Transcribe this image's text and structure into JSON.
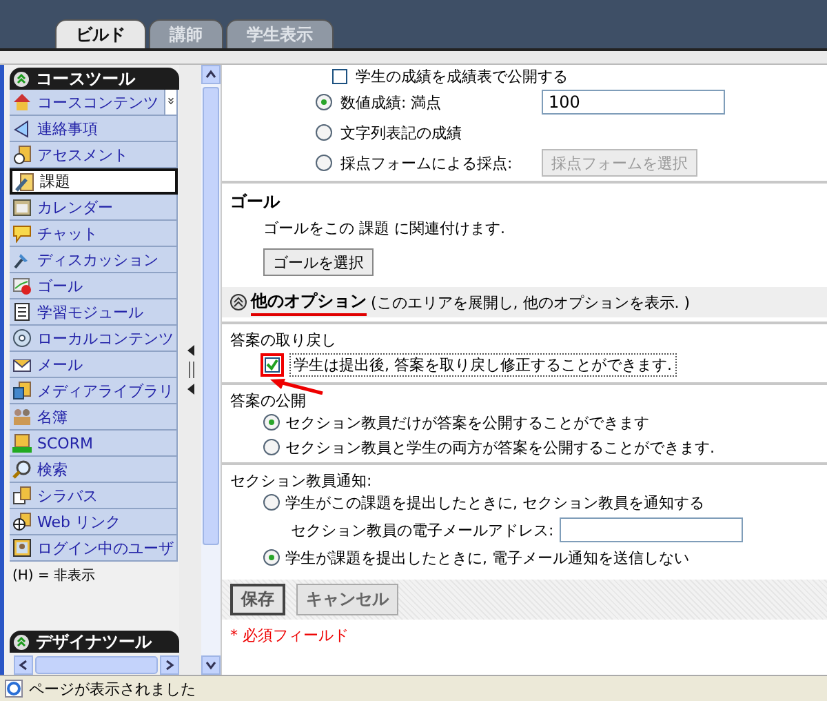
{
  "tabs": [
    {
      "label": "ビルド",
      "selected": true
    },
    {
      "label": "講師",
      "selected": false
    },
    {
      "label": "学生表示",
      "selected": false
    }
  ],
  "sidebar": {
    "header": "コースツール",
    "items": [
      {
        "label": "コースコンテンツ",
        "selected": false
      },
      {
        "label": "連絡事項",
        "selected": false
      },
      {
        "label": "アセスメント",
        "selected": false
      },
      {
        "label": "課題",
        "selected": true
      },
      {
        "label": "カレンダー",
        "selected": false
      },
      {
        "label": "チャット",
        "selected": false
      },
      {
        "label": "ディスカッション",
        "selected": false
      },
      {
        "label": "ゴール",
        "selected": false
      },
      {
        "label": "学習モジュール",
        "selected": false
      },
      {
        "label": "ローカルコンテンツ",
        "selected": false
      },
      {
        "label": "メール",
        "selected": false
      },
      {
        "label": "メディアライブラリ",
        "selected": false
      },
      {
        "label": "名簿",
        "selected": false
      },
      {
        "label": "SCORM",
        "selected": false
      },
      {
        "label": "検索",
        "selected": false
      },
      {
        "label": "シラバス",
        "selected": false
      },
      {
        "label": "Web リンク",
        "selected": false
      },
      {
        "label": "ログイン中のユーザ",
        "selected": false
      }
    ],
    "legend": "(H) = 非表示",
    "second_header": "デザイナツール"
  },
  "grading": {
    "publish_option": {
      "label": "学生の成績を成績表で公開する",
      "checked": false
    },
    "options": [
      {
        "kind": "input",
        "label": "数値成績: 満点",
        "selected": true,
        "value": "100"
      },
      {
        "kind": "plain",
        "label": "文字列表記の成績",
        "selected": false
      },
      {
        "kind": "button",
        "label": "採点フォームによる採点:",
        "selected": false,
        "button": "採点フォームを選択",
        "button_disabled": true
      }
    ]
  },
  "goal": {
    "heading": "ゴール",
    "description": "ゴールをこの 課題 に関連付けます.",
    "button": "ゴールを選択"
  },
  "more_options": {
    "title": "他のオプション",
    "hint": "(このエリアを展開し, 他のオプションを表示. )",
    "expanded": true,
    "underlined": true
  },
  "retract": {
    "heading": "答案の取り戻し",
    "option": {
      "label": "学生は提出後, 答案を取り戻し修正することができます.",
      "checked": true,
      "highlighted": true
    }
  },
  "publish": {
    "heading": "答案の公開",
    "options": [
      {
        "label": "セクション教員だけが答案を公開することができます",
        "selected": true
      },
      {
        "label": "セクション教員と学生の両方が答案を公開することができます.",
        "selected": false
      }
    ]
  },
  "notify": {
    "heading": "セクション教員通知:",
    "options": [
      {
        "label": "学生がこの課題を提出したときに, セクション教員を通知する",
        "selected": false,
        "email_label": "セクション教員の電子メールアドレス:"
      },
      {
        "label": "学生が課題を提出したときに, 電子メール通知を送信しない",
        "selected": true
      }
    ]
  },
  "actions": [
    {
      "label": "保存",
      "primary": true
    },
    {
      "label": "キャンセル",
      "primary": false
    }
  ],
  "required_note": "*  必須フィールド",
  "status_bar": {
    "text": "ページが表示されました"
  }
}
